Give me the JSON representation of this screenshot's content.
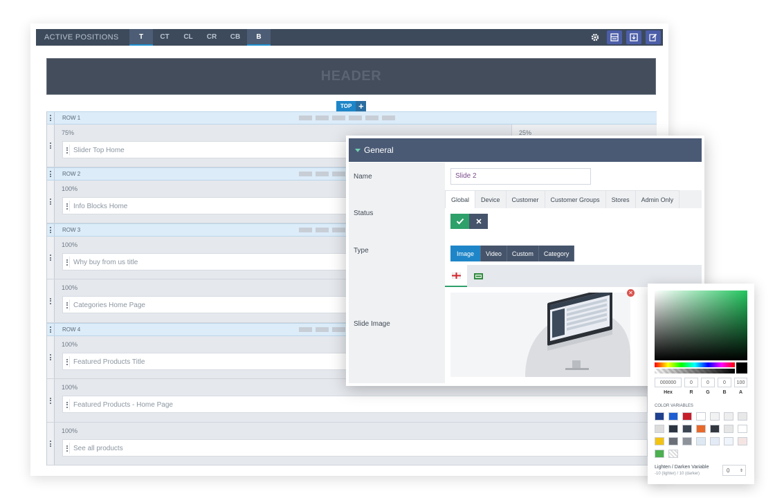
{
  "topbar": {
    "title": "ACTIVE POSITIONS",
    "tabs": [
      "T",
      "CT",
      "CL",
      "CR",
      "CB",
      "B"
    ],
    "active_tabs": [
      "T",
      "B"
    ],
    "icons": [
      "gear-icon",
      "layout-save-icon",
      "download-icon",
      "edit-icon"
    ]
  },
  "header_block": "HEADER",
  "position_pill": {
    "label": "TOP",
    "add": "+"
  },
  "rows": [
    {
      "name": "ROW 1",
      "columns": [
        {
          "width": "75%",
          "module": "Slider Top Home"
        },
        {
          "width": "25%"
        }
      ]
    },
    {
      "name": "ROW 2",
      "columns": [
        {
          "width": "100%",
          "module": "Info Blocks Home"
        }
      ]
    },
    {
      "name": "ROW 3",
      "columns": [
        {
          "width": "100%",
          "module": "Why buy from us title"
        },
        {
          "width": "100%",
          "module": "Categories Home Page"
        }
      ]
    },
    {
      "name": "ROW 4",
      "columns": [
        {
          "width": "100%",
          "module": "Featured Products Title"
        },
        {
          "width": "100%",
          "module": "Featured Products - Home Page"
        },
        {
          "width": "100%",
          "module": "See all products"
        }
      ]
    }
  ],
  "panel": {
    "title": "General",
    "name_label": "Name",
    "name_value": "Slide 2",
    "status_label": "Status",
    "status_tabs": [
      "Global",
      "Device",
      "Customer",
      "Customer Groups",
      "Stores",
      "Admin Only"
    ],
    "status_active_tab": "Global",
    "status_enabled": true,
    "type_label": "Type",
    "type_options": [
      "Image",
      "Video",
      "Custom",
      "Category"
    ],
    "type_selected": "Image",
    "slide_image_label": "Slide Image",
    "image_lang_tabs": [
      "english-flag-icon",
      "alt-flag-icon"
    ]
  },
  "color_picker": {
    "hex": "000000",
    "r": "0",
    "g": "0",
    "b": "0",
    "a": "100",
    "labels": [
      "Hex",
      "R",
      "G",
      "B",
      "A"
    ],
    "variables_title": "COLOR VARIABLES",
    "swatches": [
      "#1f3f8f",
      "#1d5fd3",
      "#c81e2a",
      "#ffffff",
      "#f2f2f2",
      "#eeeeee",
      "#e8e8e8",
      "#dcdcdc",
      "#2b3440",
      "#3c4652",
      "#e8692a",
      "#333840",
      "#e6e6e6",
      "#ffffff",
      "#f2c313",
      "#6b7078",
      "#8e939a",
      "#dde8f3",
      "#e3ebf6",
      "#f0f4fb",
      "#f4e5e3",
      "#4caf50",
      "transparent"
    ],
    "lighten_title": "Lighten / Darken Variable",
    "lighten_sub": "-10 (lighter) / 10 (darker)",
    "lighten_value": "0"
  }
}
